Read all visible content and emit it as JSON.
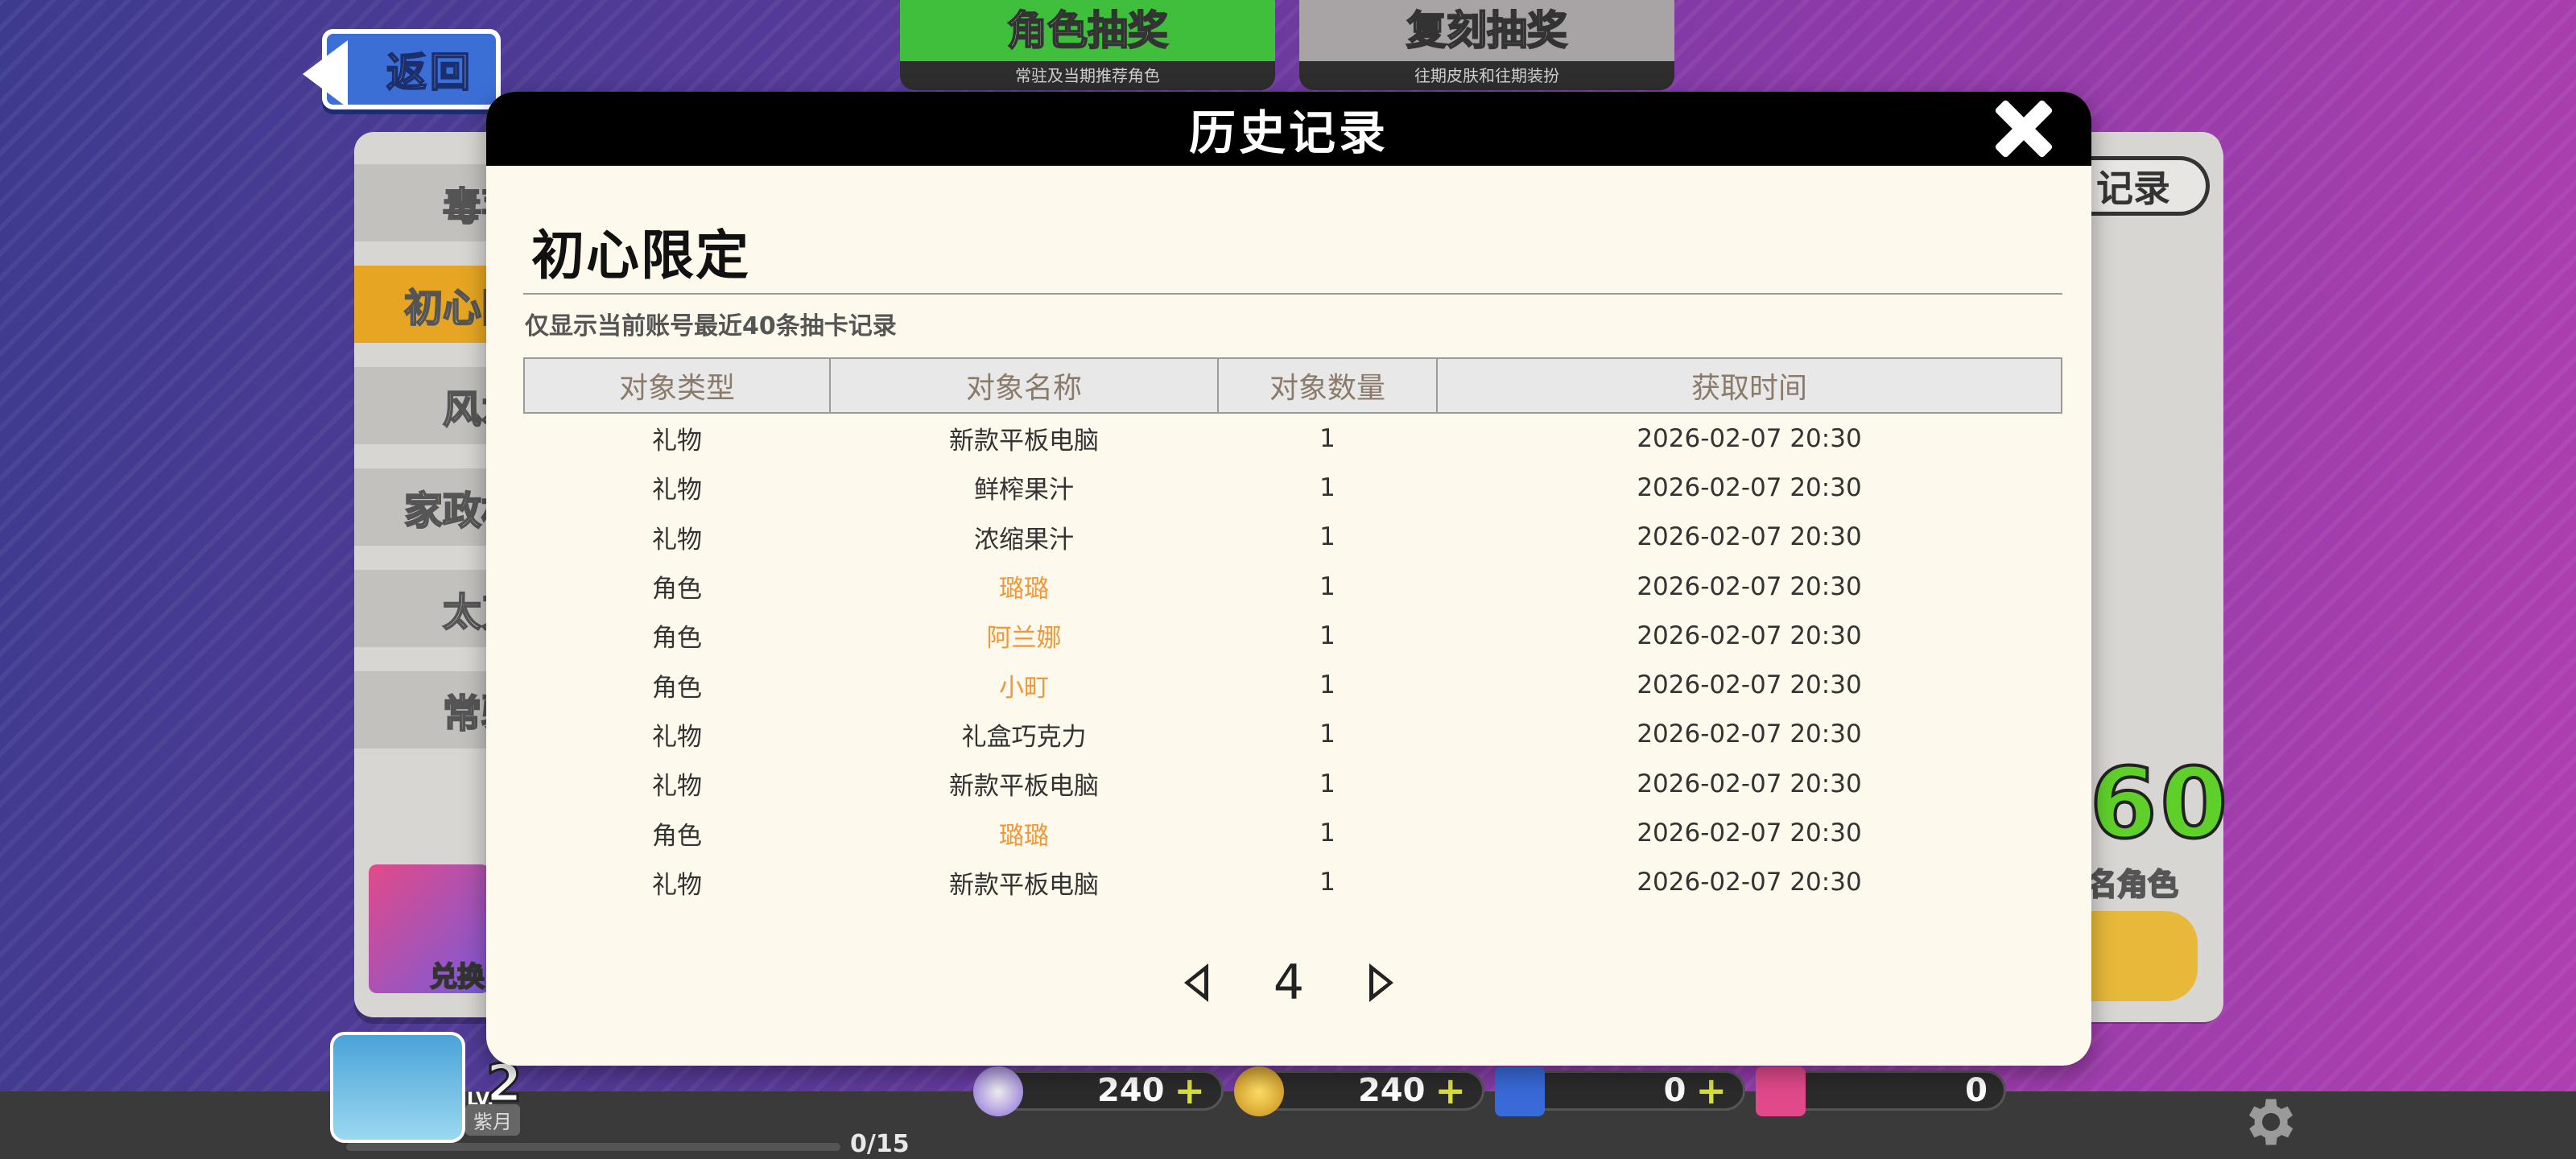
{
  "nav": {
    "back_label": "返回"
  },
  "top_tabs": [
    {
      "title": "角色抽奖",
      "subtitle": "常驻及当期推荐角色"
    },
    {
      "title": "复刻抽奖",
      "subtitle": "往期皮肤和往期装扮"
    }
  ],
  "sidebar": {
    "items": [
      {
        "label": "毒苹"
      },
      {
        "label": "初心限"
      },
      {
        "label": "风水"
      },
      {
        "label": "家政机"
      },
      {
        "label": "太刀"
      },
      {
        "label": "常驻"
      }
    ],
    "active_index": 1,
    "exchange_label": "兑换"
  },
  "right_panel": {
    "record_tag": "记录",
    "count": "60",
    "count_label": "名角色"
  },
  "player": {
    "level_prefix": "LV.",
    "level": "2",
    "name": "紫月",
    "xp": "0/15"
  },
  "currencies": [
    {
      "icon": "purple-disc-icon",
      "value": "240",
      "plus": "+"
    },
    {
      "icon": "gold-disc-icon",
      "value": "240",
      "plus": "+"
    },
    {
      "icon": "blue-ticket-icon",
      "value": "0",
      "plus": "+"
    },
    {
      "icon": "pink-ticket-icon",
      "value": "0"
    }
  ],
  "modal": {
    "title": "历史记录",
    "pool_title": "初心限定",
    "notice": "仅显示当前账号最近40条抽卡记录",
    "columns": [
      "对象类型",
      "对象名称",
      "对象数量",
      "获取时间"
    ],
    "rows": [
      {
        "type": "礼物",
        "name": "新款平板电脑",
        "qty": "1",
        "time": "2026-02-07 20:30"
      },
      {
        "type": "礼物",
        "name": "鲜榨果汁",
        "qty": "1",
        "time": "2026-02-07 20:30"
      },
      {
        "type": "礼物",
        "name": "浓缩果汁",
        "qty": "1",
        "time": "2026-02-07 20:30"
      },
      {
        "type": "角色",
        "name": "璐璐",
        "qty": "1",
        "time": "2026-02-07 20:30"
      },
      {
        "type": "角色",
        "name": "阿兰娜",
        "qty": "1",
        "time": "2026-02-07 20:30"
      },
      {
        "type": "角色",
        "name": "小町",
        "qty": "1",
        "time": "2026-02-07 20:30"
      },
      {
        "type": "礼物",
        "name": "礼盒巧克力",
        "qty": "1",
        "time": "2026-02-07 20:30"
      },
      {
        "type": "礼物",
        "name": "新款平板电脑",
        "qty": "1",
        "time": "2026-02-07 20:30"
      },
      {
        "type": "角色",
        "name": "璐璐",
        "qty": "1",
        "time": "2026-02-07 20:30"
      },
      {
        "type": "礼物",
        "name": "新款平板电脑",
        "qty": "1",
        "time": "2026-02-07 20:30"
      }
    ],
    "page": "4"
  },
  "colors": {
    "role_name": "#f0973a",
    "tab_active": "#3fbf3c",
    "sidebar_active": "#e6a623"
  }
}
